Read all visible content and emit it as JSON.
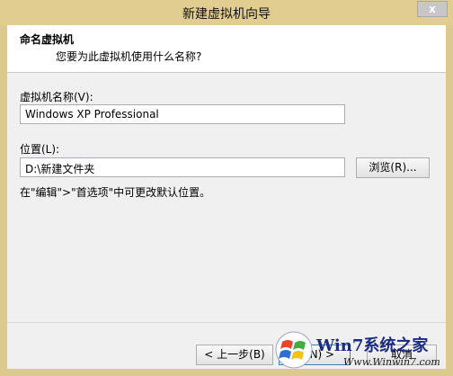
{
  "window": {
    "title": "新建虚拟机向导",
    "close_label": "x"
  },
  "header": {
    "title": "命名虚拟机",
    "subtitle": "您要为此虚拟机使用什么名称?"
  },
  "form": {
    "name_label": "虚拟机名称(V):",
    "name_value": "Windows XP Professional",
    "location_label": "位置(L):",
    "location_value": "D:\\新建文件夹",
    "browse_label": "浏览(R)...",
    "hint": "在\"编辑\">\"首选项\"中可更改默认位置。"
  },
  "footer": {
    "back_label": "< 上一步(B)",
    "next_label": "步(N) >",
    "cancel_label": "取消"
  },
  "watermark": {
    "text": "Win7系统之家",
    "url": "Www.Winwin7.com"
  }
}
